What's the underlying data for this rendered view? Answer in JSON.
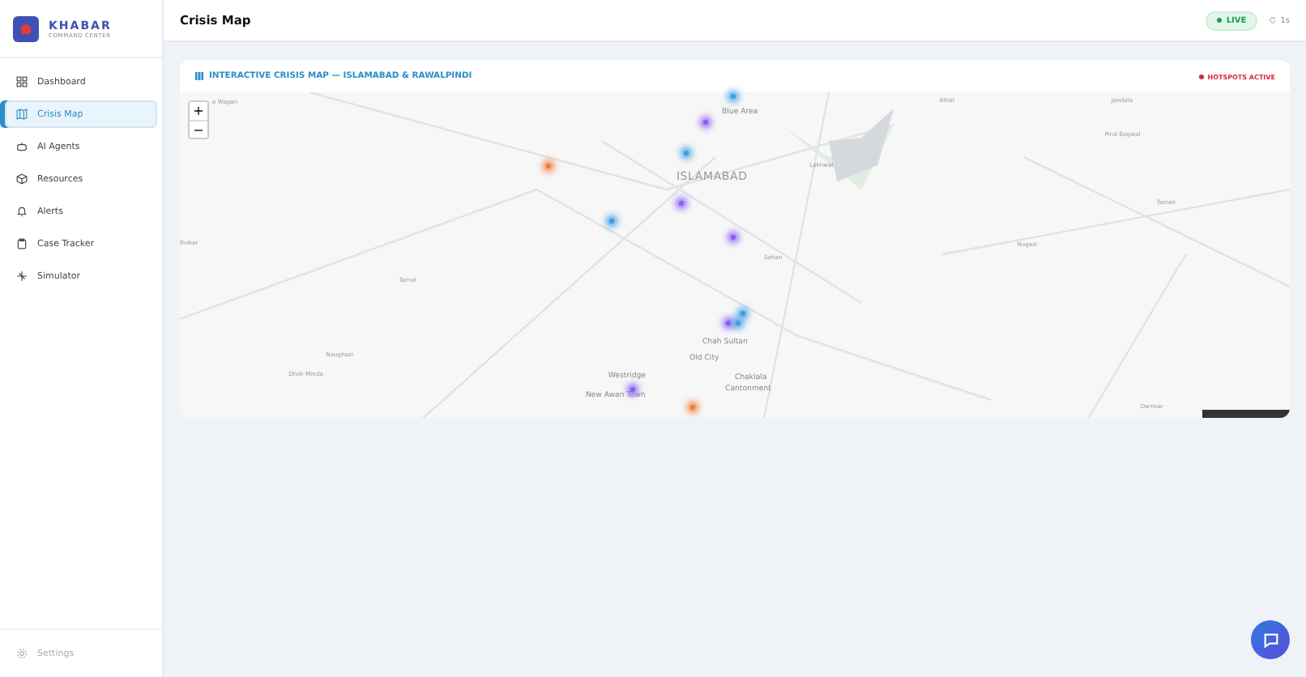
{
  "brand": {
    "name": "KHABAR",
    "tagline": "COMMAND CENTER"
  },
  "nav": [
    {
      "label": "Dashboard",
      "selected": false
    },
    {
      "label": "Crisis Map",
      "selected": true
    },
    {
      "label": "AI Agents",
      "selected": false
    },
    {
      "label": "Resources",
      "selected": false
    },
    {
      "label": "Alerts",
      "selected": false
    },
    {
      "label": "Case Tracker",
      "selected": false
    },
    {
      "label": "Simulator",
      "selected": false
    }
  ],
  "settings": {
    "label": "Settings"
  },
  "header": {
    "title": "Crisis Map",
    "live": "LIVE",
    "refresh": "1s"
  },
  "map_card": {
    "title": "INTERACTIVE CRISIS MAP — ISLAMABAD & RAWALPINDI",
    "status": "HOTSPOTS ACTIVE",
    "zoom_in": "+",
    "zoom_out": "−",
    "places": [
      {
        "name": "e Wagan",
        "kind": "minor"
      },
      {
        "name": "Blue Area",
        "kind": "area"
      },
      {
        "name": "ISLAMABAD",
        "kind": "city"
      },
      {
        "name": "Sohan",
        "kind": "minor"
      },
      {
        "name": "Chah Sultan",
        "kind": "area"
      },
      {
        "name": "Old City",
        "kind": "area"
      },
      {
        "name": "Chaklala",
        "kind": "area"
      },
      {
        "name": "Cantonment",
        "kind": "area"
      },
      {
        "name": "Westridge",
        "kind": "area"
      },
      {
        "name": "New Awan Town",
        "kind": "area"
      },
      {
        "name": "Tarnol",
        "kind": "minor"
      },
      {
        "name": "Naughazi",
        "kind": "minor"
      },
      {
        "name": "Dhok Minda",
        "kind": "minor"
      },
      {
        "name": "Lakhwal",
        "kind": "minor"
      },
      {
        "name": "Pind Begwal",
        "kind": "minor"
      },
      {
        "name": "Tamair",
        "kind": "minor"
      },
      {
        "name": "Nogazi",
        "kind": "minor"
      },
      {
        "name": "Athal",
        "kind": "minor"
      },
      {
        "name": "Jandala",
        "kind": "minor"
      },
      {
        "name": "Damsar",
        "kind": "minor"
      },
      {
        "name": "Ihokar",
        "kind": "minor"
      }
    ],
    "hotspots": [
      {
        "color": "#3b9ee0"
      },
      {
        "color": "#8b5cf6"
      },
      {
        "color": "#3b9ee0"
      },
      {
        "color": "#f07a3a"
      },
      {
        "color": "#8b5cf6"
      },
      {
        "color": "#3b9ee0"
      },
      {
        "color": "#8b5cf6"
      },
      {
        "color": "#3b9ee0"
      },
      {
        "color": "#8b5cf6"
      },
      {
        "color": "#3b9ee0"
      },
      {
        "color": "#8b5cf6"
      },
      {
        "color": "#f07a3a"
      }
    ]
  }
}
